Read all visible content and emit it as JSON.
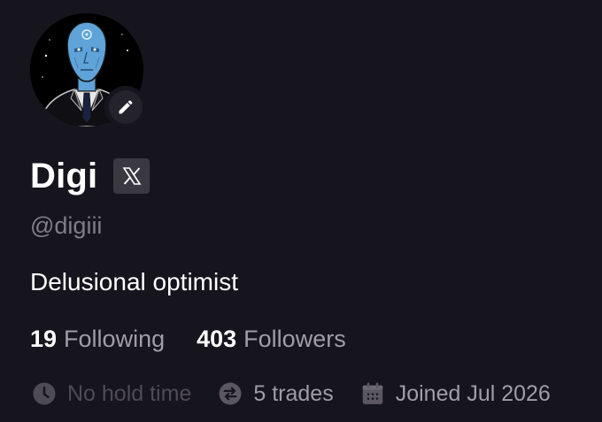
{
  "profile": {
    "name": "Digi",
    "handle": "@digiii",
    "bio": "Delusional optimist",
    "following_count": "19",
    "following_label": "Following",
    "followers_count": "403",
    "followers_label": "Followers",
    "hold_time": "No hold time",
    "trades": "5 trades",
    "joined": "Joined Jul 2026"
  },
  "icons": {
    "edit": "pencil-icon",
    "social": "x-logo-icon",
    "hold_time": "clock-icon",
    "trades": "swap-arrows-icon",
    "joined": "calendar-icon"
  },
  "colors": {
    "background": "#16141c",
    "primary_text": "#ffffff",
    "secondary_text": "#a09da8",
    "muted_text": "#4e4b55",
    "badge_bg": "#3a3841",
    "avatar_skin": "#5fa3d8"
  }
}
